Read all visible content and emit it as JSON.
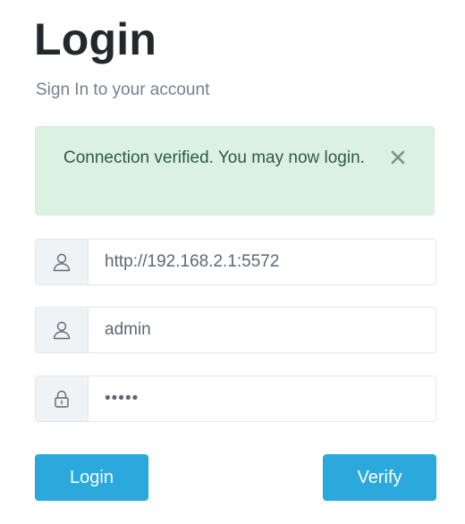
{
  "header": {
    "title": "Login",
    "subtitle": "Sign In to your account"
  },
  "alert": {
    "message": "Connection verified. You may now login.",
    "type": "success",
    "close_icon": "close-icon",
    "colors": {
      "background": "#dbf2e3",
      "text": "#2f5a3f"
    }
  },
  "form": {
    "server": {
      "icon": "user-icon",
      "value": "http://192.168.2.1:5572"
    },
    "username": {
      "icon": "user-icon",
      "value": "admin"
    },
    "password": {
      "icon": "lock-icon",
      "value": "•••••"
    }
  },
  "buttons": {
    "login_label": "Login",
    "verify_label": "Verify",
    "color": "#2ba9dc"
  }
}
